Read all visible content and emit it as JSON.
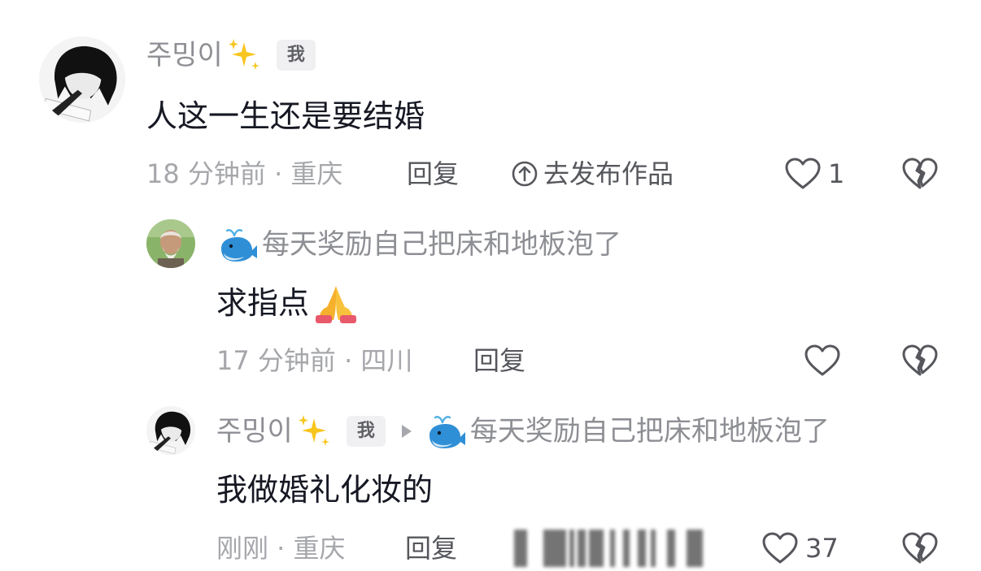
{
  "colors": {
    "username": "#8e8f94",
    "text": "#161823",
    "meta": "#a6a7ab",
    "action": "#56575c",
    "badge_bg": "#f0f0f2"
  },
  "comments": [
    {
      "username": "주밍이",
      "username_suffix_icon": "sparkles-icon",
      "badge": "我",
      "text": "人这一生还是要结婚",
      "time_location": "18 分钟前 · 重庆",
      "reply_label": "回复",
      "publish_icon": "arrow-up-circle-icon",
      "publish_label": "去发布作品",
      "like_count": "1",
      "avatar_icon": "dark-hair-avatar"
    },
    {
      "username": "每天奖励自己把床和地板泡了",
      "username_prefix_icon": "whale-icon",
      "text": "求指点",
      "text_emoji": "folded-hands-icon",
      "time_location": "17 分钟前 · 四川",
      "reply_label": "回复",
      "like_count": "",
      "avatar_icon": "elder-portrait-avatar"
    },
    {
      "username": "주밍이",
      "username_suffix_icon": "sparkles-icon",
      "badge": "我",
      "reply_to_icon": "reply-arrow-icon",
      "reply_to_prefix_icon": "whale-icon",
      "reply_to_username": "每天奖励自己把床和地板泡了",
      "text": "我做婚礼化妆的",
      "time_location": "刚刚 · 重庆",
      "reply_label": "回复",
      "like_count": "37",
      "avatar_icon": "dark-hair-avatar"
    }
  ]
}
